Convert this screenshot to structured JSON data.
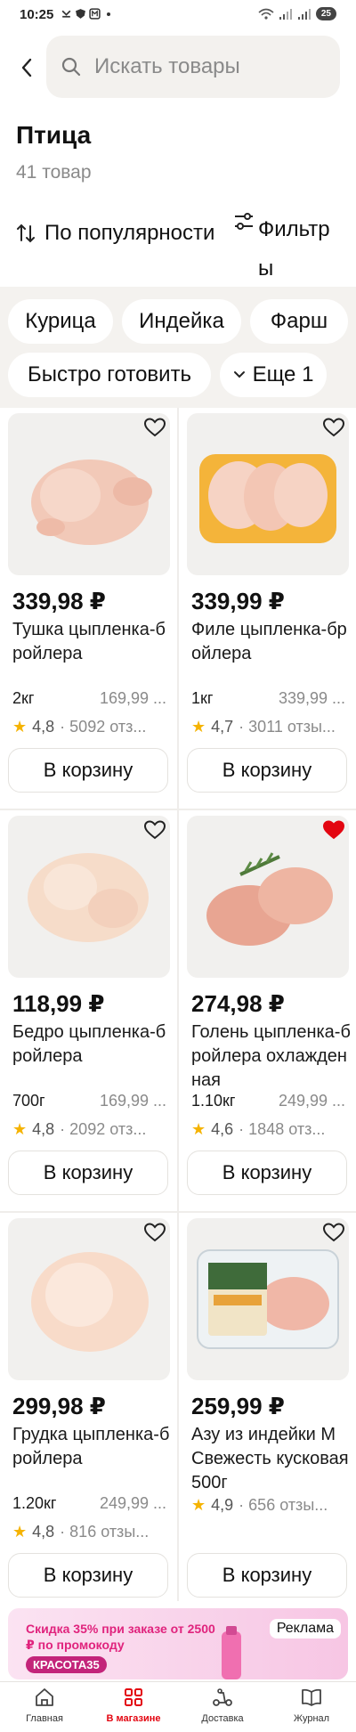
{
  "status_bar": {
    "time": "10:25",
    "battery": "25"
  },
  "search": {
    "placeholder": "Искать товары"
  },
  "category": {
    "title": "Птица",
    "count": "41 товар"
  },
  "sort": {
    "label": "По популярности"
  },
  "filters": {
    "label": "Фильтры"
  },
  "chips": [
    "Курица",
    "Индейка",
    "Фарш",
    "Быстро готовить",
    "Еще 1"
  ],
  "products": [
    {
      "price": "339,98 ₽",
      "name": "Тушка цыпленка-бройлера",
      "weight": "2кг",
      "unit_price": "169,99 ...",
      "rating": "4,8",
      "reviews": "· 5092 отз...",
      "cart": "В корзину",
      "favorite": false
    },
    {
      "price": "339,99 ₽",
      "name": "Филе цыпленка-бройлера",
      "weight": "1кг",
      "unit_price": "339,99 ...",
      "rating": "4,7",
      "reviews": "· 3011 отзы...",
      "cart": "В корзину",
      "favorite": false
    },
    {
      "price": "118,99 ₽",
      "name": "Бедро цыпленка-бройлера",
      "weight": "700г",
      "unit_price": "169,99 ...",
      "rating": "4,8",
      "reviews": "· 2092 отз...",
      "cart": "В корзину",
      "favorite": false
    },
    {
      "price": "274,98 ₽",
      "name": "Голень цыпленка-бройлера охлажденная",
      "weight": "1.10кг",
      "unit_price": "249,99 ...",
      "rating": "4,6",
      "reviews": "· 1848 отз...",
      "cart": "В корзину",
      "favorite": true
    },
    {
      "price": "299,98 ₽",
      "name": "Грудка цыпленка-бройлера",
      "weight": "1.20кг",
      "unit_price": "249,99 ...",
      "rating": "4,8",
      "reviews": "· 816 отзы...",
      "cart": "В корзину",
      "favorite": false
    },
    {
      "price": "259,99 ₽",
      "name": "Азу из индейки М Свежесть кусковая 500г",
      "weight": "",
      "unit_price": "",
      "rating": "4,9",
      "reviews": "· 656 отзы...",
      "cart": "В корзину",
      "favorite": false
    }
  ],
  "ad": {
    "text": "Скидка 35% при заказе от 2500 ₽ по промокоду",
    "code": "КРАСОТА35",
    "label": "Реклама"
  },
  "nav": [
    {
      "label": "Главная",
      "icon": "home-icon"
    },
    {
      "label": "В магазине",
      "icon": "grid-icon",
      "active": true
    },
    {
      "label": "Доставка",
      "icon": "scooter-icon"
    },
    {
      "label": "Журнал",
      "icon": "book-icon"
    }
  ],
  "colors": {
    "accent": "#e30611",
    "chip_bg": "#f4f2ef",
    "star": "#f5b301"
  }
}
